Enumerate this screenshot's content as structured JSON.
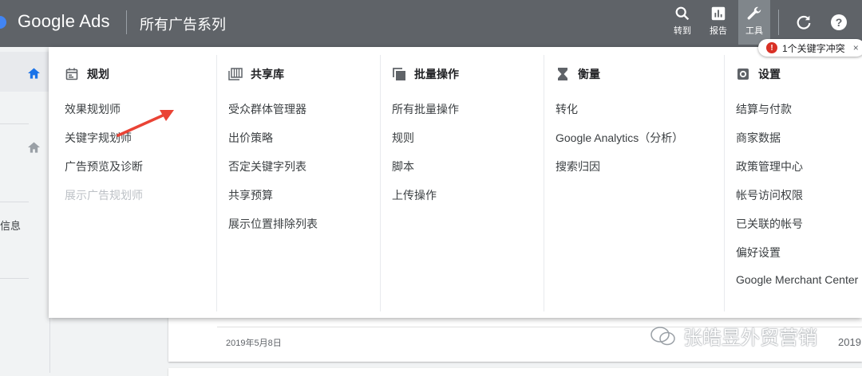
{
  "topbar": {
    "brand": "Google Ads",
    "page_title": "所有广告系列",
    "items": [
      {
        "label": "转到",
        "icon": "search-icon"
      },
      {
        "label": "报告",
        "icon": "bar-chart-icon"
      },
      {
        "label": "工具",
        "icon": "wrench-icon"
      }
    ],
    "refresh_icon": "refresh-icon",
    "help_icon": "help-icon",
    "colors": {
      "bar": "#5f6368",
      "active": "#80868b"
    }
  },
  "conflict_chip": {
    "count": "1",
    "label": "1个关键字冲突",
    "close": "×"
  },
  "sidebar": {
    "text": "信息"
  },
  "menu": {
    "columns": [
      {
        "heading": "规划",
        "icon": "calendar-icon",
        "items": [
          "效果规划师",
          "关键字规划师",
          "广告预览及诊断",
          "展示广告规划师"
        ]
      },
      {
        "heading": "共享库",
        "icon": "library-icon",
        "items": [
          "受众群体管理器",
          "出价策略",
          "否定关键字列表",
          "共享预算",
          "展示位置排除列表"
        ]
      },
      {
        "heading": "批量操作",
        "icon": "copy-icon",
        "items": [
          "所有批量操作",
          "规则",
          "脚本",
          "上传操作"
        ]
      },
      {
        "heading": "衡量",
        "icon": "hourglass-icon",
        "items": [
          "转化",
          "Google Analytics（分析）",
          "搜索归因"
        ]
      },
      {
        "heading": "设置",
        "icon": "settings-icon",
        "items": [
          "结算与付款",
          "商家数据",
          "政策管理中心",
          "帐号访问权限",
          "已关联的帐号",
          "偏好设置",
          "Google Merchant Center"
        ]
      }
    ]
  },
  "background": {
    "date": "2019年5月8日",
    "date_partial": "2019"
  },
  "watermark": {
    "text": "张皓昱外贸营销"
  },
  "annotation_arrow_color": "#ea4335"
}
